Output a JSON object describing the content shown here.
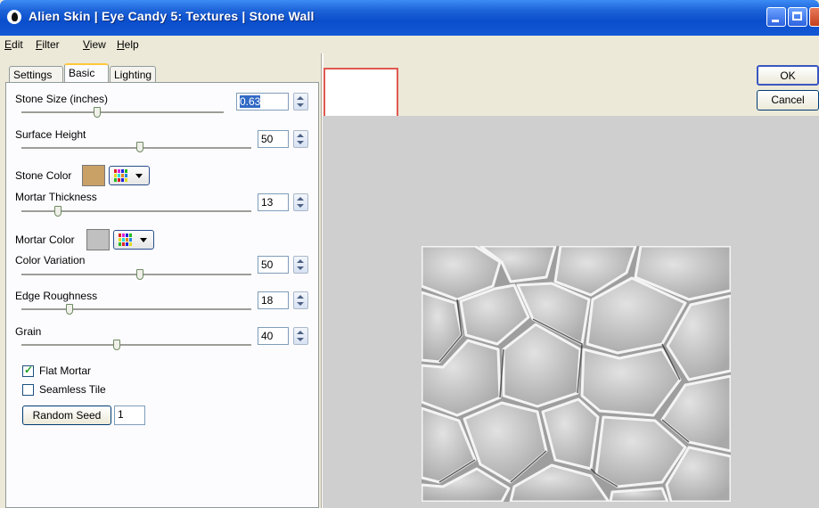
{
  "window": {
    "title": "Alien Skin | Eye Candy 5: Textures | Stone Wall"
  },
  "menu": [
    {
      "label": "Edit",
      "accel": "E",
      "rest": "dit"
    },
    {
      "label": "Filter",
      "accel": "F",
      "rest": "ilter"
    },
    {
      "label": "View",
      "accel": "V",
      "rest": "iew"
    },
    {
      "label": "Help",
      "accel": "H",
      "rest": "elp"
    }
  ],
  "tabs": {
    "settings": "Settings",
    "basic": "Basic",
    "lighting": "Lighting",
    "active": "Basic"
  },
  "params": {
    "stone_size": {
      "label": "Stone Size (inches)",
      "value": "0.63"
    },
    "surface_height": {
      "label": "Surface Height",
      "value": "50"
    },
    "stone_color": {
      "label": "Stone Color",
      "color": "#c9a066"
    },
    "mortar_thickness": {
      "label": "Mortar Thickness",
      "value": "13"
    },
    "mortar_color": {
      "label": "Mortar Color",
      "color": "#c0c0c0"
    },
    "color_variation": {
      "label": "Color Variation",
      "value": "50"
    },
    "edge_roughness": {
      "label": "Edge Roughness",
      "value": "18"
    },
    "grain": {
      "label": "Grain",
      "value": "40"
    }
  },
  "options": {
    "flat_mortar": {
      "label": "Flat Mortar",
      "checked": true
    },
    "seamless_tile": {
      "label": "Seamless Tile",
      "checked": false
    }
  },
  "random_seed": {
    "button": "Random Seed",
    "value": "1"
  },
  "buttons": {
    "ok": "OK",
    "cancel": "Cancel"
  },
  "tools": [
    "zoom-compare-icon",
    "hand-icon",
    "magnifier-icon"
  ],
  "colors": {
    "title_blue": "#0a4ecb",
    "preview_bg": "#cfcfcf",
    "nav_border": "#e0584f"
  }
}
